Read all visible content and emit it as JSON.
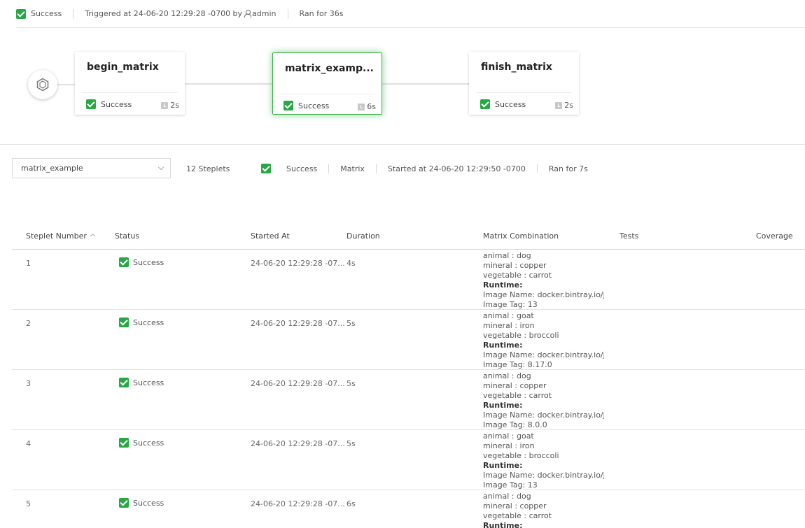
{
  "run": {
    "status": "Success",
    "triggered": "Triggered at 24-06-20 12:29:28 -0700 by",
    "user": "admin",
    "ran_for": "Ran for 36s"
  },
  "pipeline": {
    "nodes": [
      {
        "name": "begin_matrix",
        "status": "Success",
        "duration": "2s"
      },
      {
        "name": "matrix_examp...",
        "status": "Success",
        "duration": "6s"
      },
      {
        "name": "finish_matrix",
        "status": "Success",
        "duration": "2s"
      }
    ]
  },
  "step": {
    "selected": "matrix_example",
    "steplets": "12 Steplets",
    "status": "Success",
    "type": "Matrix",
    "started": "Started at 24-06-20 12:29:50 -0700",
    "ran_for": "Ran for 7s"
  },
  "table": {
    "headers": {
      "number": "Steplet Number",
      "status": "Status",
      "started": "Started At",
      "duration": "Duration",
      "matrix": "Matrix Combination",
      "tests": "Tests",
      "coverage": "Coverage"
    },
    "rows": [
      {
        "number": "1",
        "status": "Success",
        "started": "24-06-20 12:29:28 -07...",
        "duration": "4s",
        "lines": [
          "animal : dog",
          "mineral : copper",
          "vegetable : carrot",
          "Runtime:",
          "Image Name: docker.bintray.io/jfrog",
          "Image Tag: 13"
        ]
      },
      {
        "number": "2",
        "status": "Success",
        "started": "24-06-20 12:29:28 -07...",
        "duration": "5s",
        "lines": [
          "animal : goat",
          "mineral : iron",
          "vegetable : broccoli",
          "Runtime:",
          "Image Name: docker.bintray.io/jfrog",
          "Image Tag: 8.17.0"
        ]
      },
      {
        "number": "3",
        "status": "Success",
        "started": "24-06-20 12:29:28 -07...",
        "duration": "5s",
        "lines": [
          "animal : dog",
          "mineral : copper",
          "vegetable : carrot",
          "Runtime:",
          "Image Name: docker.bintray.io/jfrog",
          "Image Tag: 8.0.0"
        ]
      },
      {
        "number": "4",
        "status": "Success",
        "started": "24-06-20 12:29:28 -07...",
        "duration": "5s",
        "lines": [
          "animal : goat",
          "mineral : iron",
          "vegetable : broccoli",
          "Runtime:",
          "Image Name: docker.bintray.io/jfrog",
          "Image Tag: 13"
        ]
      },
      {
        "number": "5",
        "status": "Success",
        "started": "24-06-20 12:29:28 -07...",
        "duration": "6s",
        "lines": [
          "animal : dog",
          "mineral : copper",
          "vegetable : carrot",
          "Runtime:"
        ]
      }
    ]
  }
}
